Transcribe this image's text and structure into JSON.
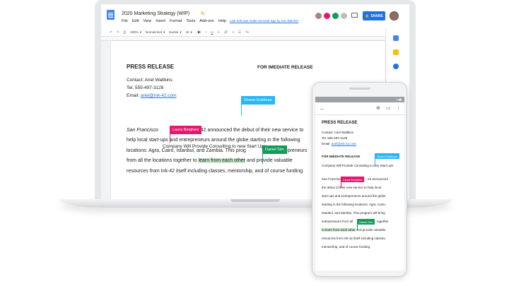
{
  "colors": {
    "docs_blue": "#1a73e8",
    "cursor_pink": "#e8166e",
    "cursor_green": "#0f9d58",
    "cursor_cyan": "#29b6f6",
    "highlight_green": "#c8e6c9"
  },
  "window": {
    "title": "2020 Marketing Strategy (WIP)",
    "menu": [
      "File",
      "Edit",
      "View",
      "Insert",
      "Format",
      "Tools",
      "Add-ons",
      "Help"
    ],
    "last_edit": "Last edit was made seconds ago by Ken Blacher",
    "share_label": "SHARE"
  },
  "toolbar": {
    "zoom": "100%",
    "style": "Normal text",
    "font": "Nunito",
    "size": "10",
    "bold": "B",
    "italic": "I",
    "underline": "U"
  },
  "document": {
    "title": "PRESS RELEASE",
    "release_tag": "FOR IMEDIATE RELEASE",
    "contact": "Contact: Ariel Waltkins",
    "tel": "Tel. 555-497-3128",
    "email_label": "Email: ",
    "email": "ariel@ink-42.com",
    "subhead": "Company Will Provide Consulting to new Start Ups",
    "body_line1_italic": "San Francisco",
    "body_line1_rest": "42 announced the debut of their new service to",
    "body_line2": "help local start-ups and entrepreneurs around the globe starting in the following",
    "body_line3_a": "locations: Agra, Cairo, Istanbul, and Zambia. This prog",
    "body_line3_b": "entrepreneurs",
    "body_line4_a": "from all the locations together to ",
    "body_line4_hl": "learn from each other",
    "body_line4_b": " and provide valuable",
    "body_line5": "resources from Ink-42 itself including classes, mentorship, and of course funding."
  },
  "collaborators": {
    "shana": "Shana Goldman",
    "laura": "Laura Borghesi",
    "daniel": "Daniel Sim"
  },
  "phone": {
    "title": "PRESS RELEASE",
    "contact": "Contact: Ariel Waltkins",
    "tel": "Tel. 555-497-3128",
    "email_label": "Email: ",
    "email": "ariel@ink-42.com",
    "release_tag": "FOR IMEDIATE RELEASE",
    "subhead": "Company Will Provide Consulting to new Start Ups",
    "l1a": "San Francisco",
    "l1b": "-42 announced",
    "l2": "the debut of their new service to help local",
    "l3": "start-ups and entrepreneurs around the globe",
    "l4": "starting in the following locations: Agra, Cairo,",
    "l5": "Istanbul, and Zambia. This program will bring",
    "l6a": "entrepreneurs from all",
    "l6b": "together",
    "l7a": "to learn from each other",
    "l7b": " and provide valuable",
    "l8": "resources from Ink-42 itself including classes,",
    "l9": "mentorship, and of course funding."
  }
}
